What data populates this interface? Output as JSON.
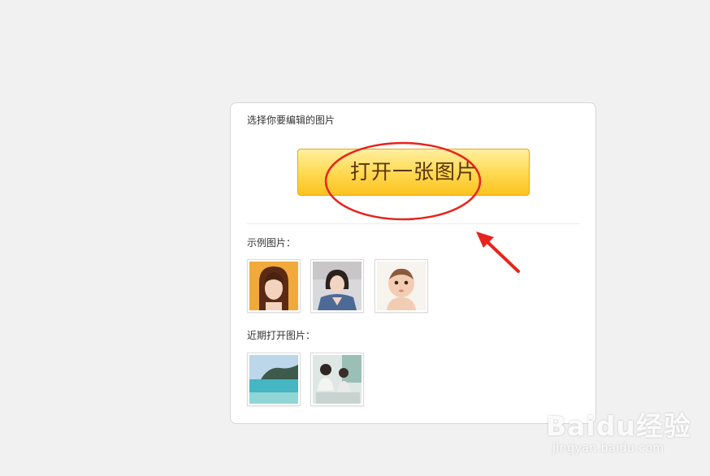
{
  "dialog": {
    "heading": "选择你要编辑的图片",
    "open_button_label": "打开一张图片",
    "samples_label": "示例图片：",
    "recent_label": "近期打开图片："
  },
  "sample_images": [
    {
      "subject": "woman with bangs on orange background"
    },
    {
      "subject": "woman in denim jacket selfie"
    },
    {
      "subject": "baby portrait"
    }
  ],
  "recent_images": [
    {
      "subject": "tropical sea and island"
    },
    {
      "subject": "two women at laptops"
    }
  ],
  "watermark": {
    "logo": "Baidu经验",
    "url": "jingyan.baidu.com"
  },
  "colors": {
    "page_background": "#f1f1f1",
    "button_gradient_top": "#ffef9e",
    "button_gradient_bottom": "#fcc21f",
    "button_text": "#5b3408",
    "annotation_red": "#e8231d"
  }
}
